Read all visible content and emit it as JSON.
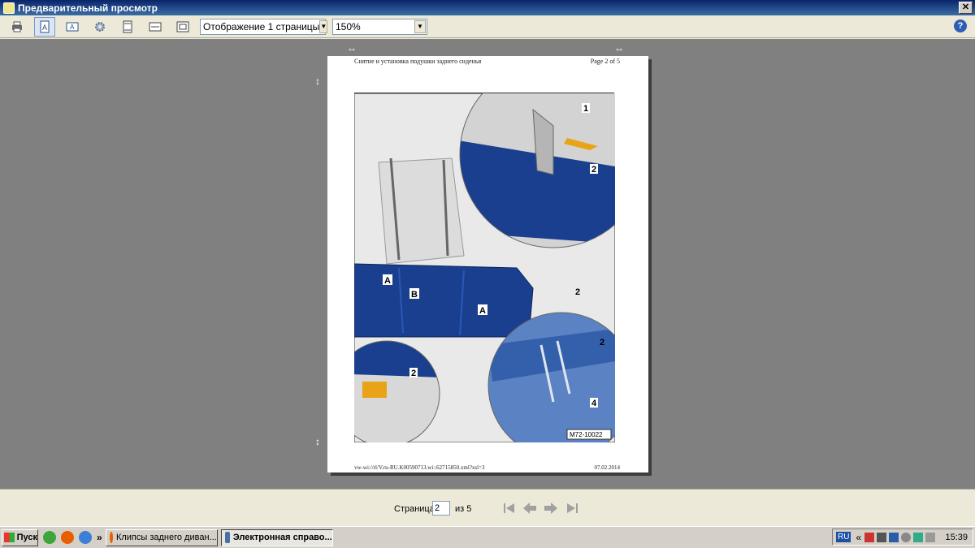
{
  "window": {
    "title": "Предварительный просмотр",
    "close_label": "✕"
  },
  "toolbar": {
    "view_mode": "Отображение 1 страницы",
    "zoom": "150%",
    "help_label": "?"
  },
  "document": {
    "header_left": "Снятие и установка подушки заднего сиденья",
    "header_right": "Page 2 of 5",
    "footer_left": "vw-wi://rl/V.ru-RU.K00590713.wi::62715850.xml?xsl=3",
    "footer_right": "07.02.2014",
    "figure": {
      "callouts": [
        "1",
        "2",
        "2",
        "2",
        "2",
        "4"
      ],
      "letters": [
        "A",
        "B",
        "A"
      ],
      "code": "M72-10022",
      "colors": {
        "blue": "#1a3f8f",
        "gray": "#d9d9d9"
      }
    }
  },
  "navigation": {
    "page_label": "Страница",
    "current_page": "2",
    "of_label": "из 5"
  },
  "taskbar": {
    "start_label": "Пуск",
    "more_label": "»",
    "tasks": [
      {
        "label": "Клипсы заднего диван..."
      },
      {
        "label": "Электронная справо..."
      }
    ],
    "tray": {
      "lang": "RU",
      "chevron": "«",
      "time": "15:39"
    }
  }
}
